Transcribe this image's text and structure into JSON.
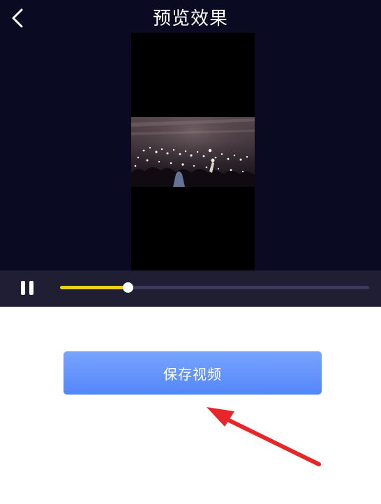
{
  "header": {
    "title": "预览效果",
    "back_icon": "chevron-left-icon"
  },
  "player": {
    "pause_icon": "pause-icon",
    "progress_fraction": 0.22,
    "colors": {
      "background": "#0b0a23",
      "control_bar": "#201e33",
      "track": "#3b3a5e",
      "progress": "#e6d11c"
    }
  },
  "actions": {
    "save_label": "保存视频",
    "save_color": "#5b8cf9"
  },
  "annotation": {
    "arrow_color": "#e8262a"
  }
}
